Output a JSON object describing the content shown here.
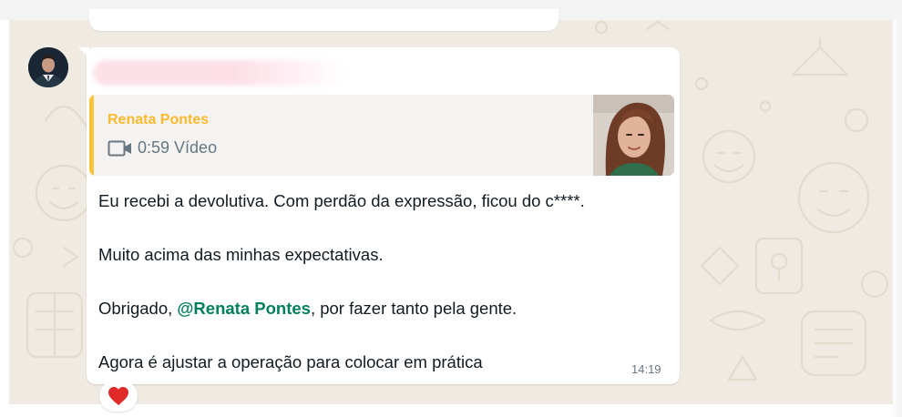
{
  "message": {
    "sender": "",
    "quoted": {
      "author": "Renata Pontes",
      "media_icon": "video-camera-icon",
      "media_label": "0:59 Vídeo"
    },
    "lines": {
      "line1": "Eu recebi a devolutiva. Com perdão da expressão, ficou do c****.",
      "line2": "Muito acima das minhas expectativas.",
      "line3_before": "Obrigado, ",
      "line3_mention": "@Renata Pontes",
      "line3_after": ", por fazer tanto pela gente.",
      "line4": "Agora é ajustar a operação para colocar em prática"
    },
    "time": "14:19",
    "reaction": "heart-icon"
  },
  "colors": {
    "chat_background": "#efeae2",
    "quote_accent": "#fcc33c",
    "quote_author": "#fcba2c",
    "mention": "#027f5d",
    "reaction": "#e02a2a"
  }
}
